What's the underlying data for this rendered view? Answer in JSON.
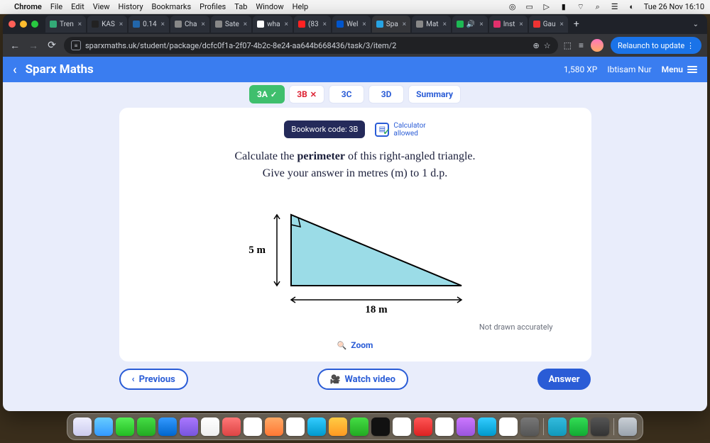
{
  "mac": {
    "app": "Chrome",
    "menus": [
      "File",
      "Edit",
      "View",
      "History",
      "Bookmarks",
      "Profiles",
      "Tab",
      "Window",
      "Help"
    ],
    "clock": "Tue 26 Nov  16:10"
  },
  "chrome": {
    "tabs": [
      "Tren",
      "KAS",
      "0.14",
      "Cha",
      "Sate",
      "wha",
      "(83",
      "Wel",
      "Spa",
      "Mat",
      "🔊",
      "Inst",
      "Gau"
    ],
    "active_tab_index": 8,
    "url": "sparxmaths.uk/student/package/dcfc0f1a-2f07-4b2c-8e24-aa644b668436/task/3/item/2",
    "relaunch": "Relaunch to update"
  },
  "sparx": {
    "brand": "Sparx Maths",
    "xp": "1,580 XP",
    "user": "Ibtisam Nur",
    "menu": "Menu"
  },
  "tabs": {
    "items": [
      {
        "label": "3A",
        "state": "done"
      },
      {
        "label": "3B",
        "state": "current"
      },
      {
        "label": "3C",
        "state": "pending"
      },
      {
        "label": "3D",
        "state": "pending"
      },
      {
        "label": "Summary",
        "state": "summary"
      }
    ]
  },
  "card": {
    "bookwork": "Bookwork code: 3B",
    "calc_l1": "Calculator",
    "calc_l2": "allowed",
    "q_l1a": "Calculate the ",
    "q_l1b": "perimeter",
    "q_l1c": " of this right-angled triangle.",
    "q_l2a": "Give your answer in metres ",
    "q_l2b": "(m)",
    "q_l2c": " to 1 d.p.",
    "side_a": "5 m",
    "side_b": "18 m",
    "note": "Not drawn accurately",
    "zoom": "Zoom"
  },
  "buttons": {
    "prev": "Previous",
    "video": "Watch video",
    "answer": "Answer"
  },
  "colors": {
    "brand_blue": "#3a7df0",
    "accent_blue": "#2a5cd6",
    "done_green": "#3fbf6d",
    "cross_red": "#d23"
  }
}
